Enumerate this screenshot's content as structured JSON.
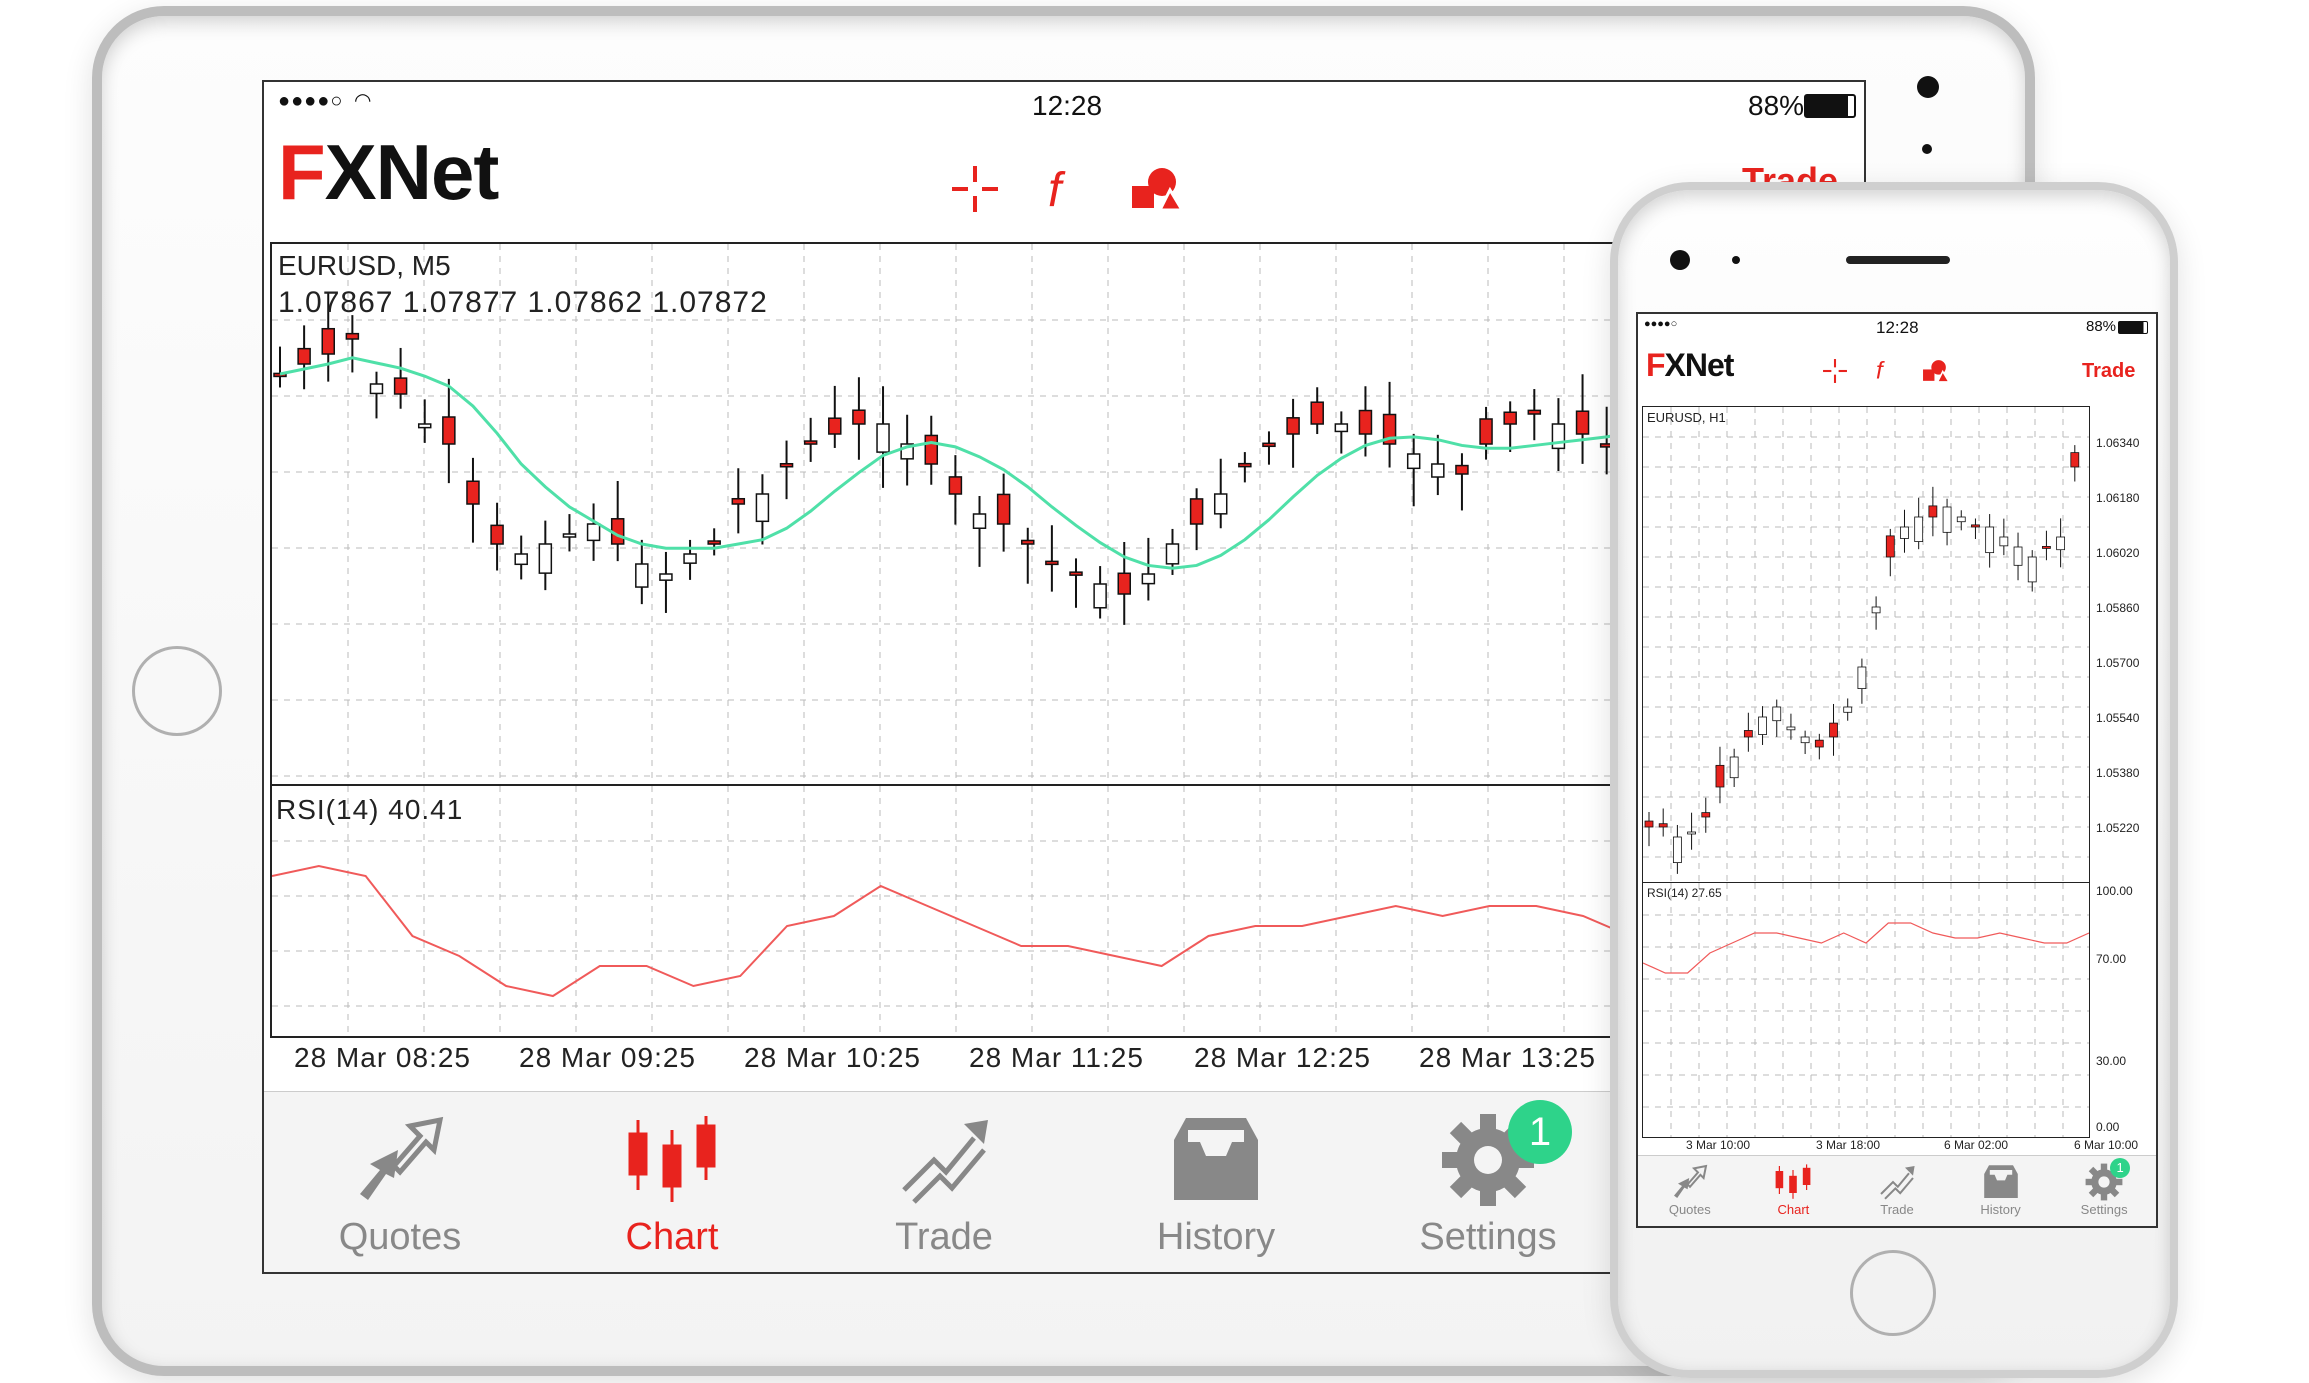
{
  "tablet": {
    "status": {
      "signal": "●●●●○",
      "time": "12:28",
      "battery": "88%"
    },
    "header": {
      "logo": "FXNet",
      "trade_label": "Trade"
    },
    "chart": {
      "symbol": "EURUSD, M5",
      "ohlc": "1.07867 1.07877 1.07862 1.07872",
      "indicator": "RSI(14) 40.41",
      "x_ticks": [
        "28 Mar 08:25",
        "28 Mar 09:25",
        "28 Mar 10:25",
        "28 Mar 11:25",
        "28 Mar 12:25",
        "28 Mar 13:25"
      ]
    },
    "tabs": [
      {
        "label": "Quotes",
        "icon": "quotes-icon"
      },
      {
        "label": "Chart",
        "icon": "candles-icon"
      },
      {
        "label": "Trade",
        "icon": "trade-icon"
      },
      {
        "label": "History",
        "icon": "inbox-icon"
      },
      {
        "label": "Settings",
        "icon": "gear-icon",
        "badge": "1"
      }
    ]
  },
  "phone": {
    "status": {
      "signal": "●●●●○",
      "time": "12:28",
      "battery": "88%"
    },
    "header": {
      "logo": "FXNet",
      "trade_label": "Trade"
    },
    "chart": {
      "symbol": "EURUSD, H1",
      "indicator": "RSI(14) 27.65",
      "price_ticks": [
        "1.06340",
        "1.06180",
        "1.06020",
        "1.05860",
        "1.05700",
        "1.05540",
        "1.05380",
        "1.05220"
      ],
      "rsi_ticks": [
        "100.00",
        "70.00",
        "30.00",
        "0.00"
      ],
      "x_ticks": [
        "3 Mar 10:00",
        "3 Mar 18:00",
        "6 Mar 02:00",
        "6 Mar 10:00"
      ]
    },
    "tabs": [
      {
        "label": "Quotes",
        "icon": "quotes-icon"
      },
      {
        "label": "Chart",
        "icon": "candles-icon"
      },
      {
        "label": "Trade",
        "icon": "trade-icon"
      },
      {
        "label": "History",
        "icon": "inbox-icon"
      },
      {
        "label": "Settings",
        "icon": "gear-icon",
        "badge": "1"
      }
    ]
  },
  "colors": {
    "accent": "#e8231e",
    "ma_line": "#4fe0a8",
    "rsi_line": "#f05a5a",
    "badge": "#2ed38a"
  }
}
